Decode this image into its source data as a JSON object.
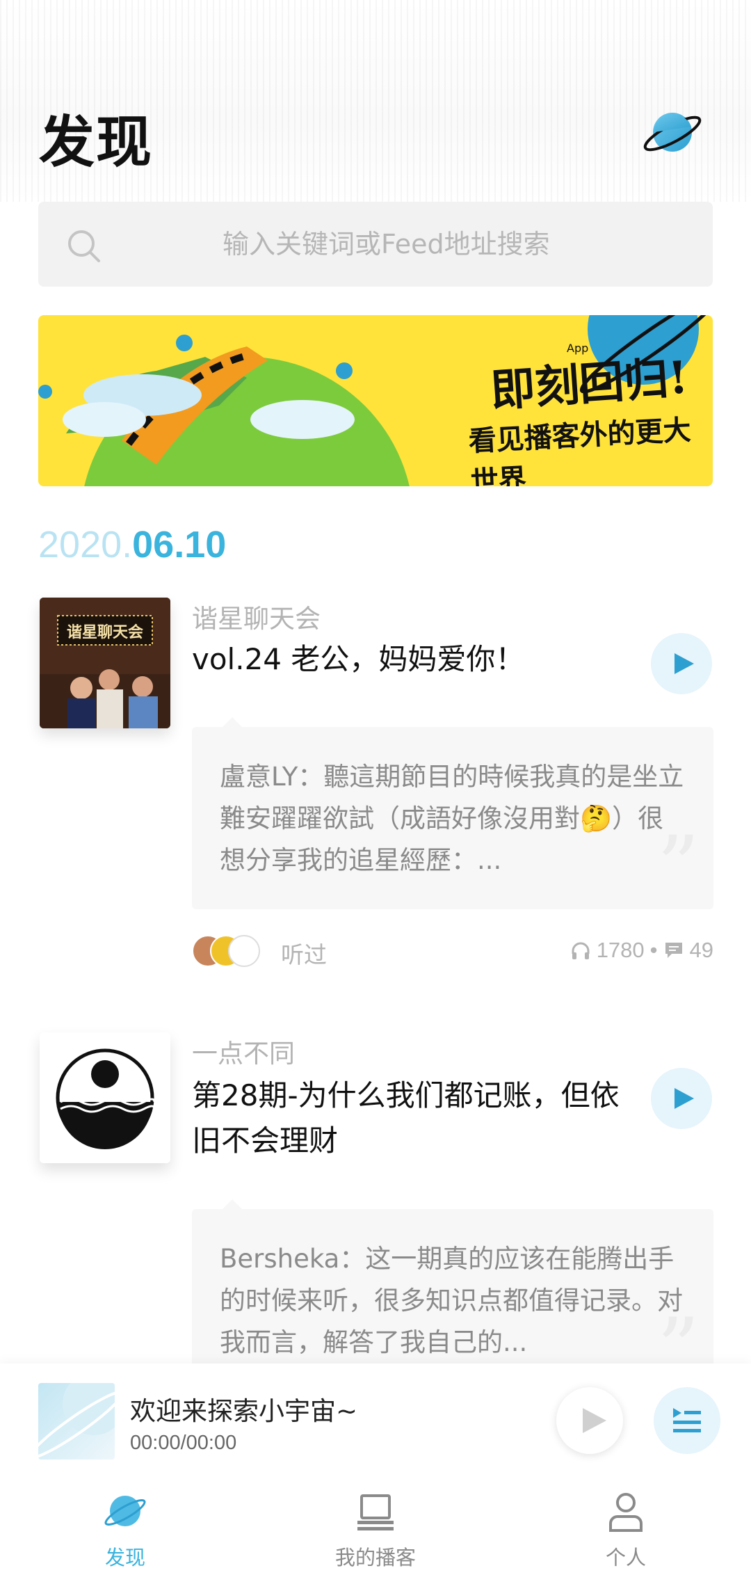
{
  "header": {
    "title": "发现",
    "planet_icon": "planet-icon"
  },
  "search": {
    "placeholder": "输入关键词或Feed地址搜索"
  },
  "banner": {
    "line1": "即刻回归!",
    "line2": "看见播客外的更大世界",
    "badge": "App"
  },
  "date": {
    "year": "2020.",
    "day": "06.10"
  },
  "episodes": [
    {
      "podcast": "谐星聊天会",
      "cover_label": "谐星聊天会",
      "title": "vol.24 老公，妈妈爱你！",
      "comment": "盧意LY：聽這期節目的時候我真的是坐立難安躍躍欲試（成語好像沒用對🤔）很想分享我的追星經歷：...",
      "listened_label": "听过",
      "plays": "1780",
      "comments": "49"
    },
    {
      "podcast": "一点不同",
      "title": "第28期-为什么我们都记账，但依旧不会理财",
      "comment": "Bersheka：这一期真的应该在能腾出手的时候来听，很多知识点都值得记录。对我而言，解答了我自己的..."
    }
  ],
  "player": {
    "title": "欢迎来探索小宇宙~",
    "time": "00:00/00:00"
  },
  "tabs": [
    {
      "label": "发现",
      "icon": "planet-icon",
      "active": true
    },
    {
      "label": "我的播客",
      "icon": "laptop-icon",
      "active": false
    },
    {
      "label": "个人",
      "icon": "person-icon",
      "active": false
    }
  ],
  "colors": {
    "accent": "#3ab3dd",
    "accent_light": "#e6f4fb",
    "banner_yellow": "#ffe33b"
  }
}
